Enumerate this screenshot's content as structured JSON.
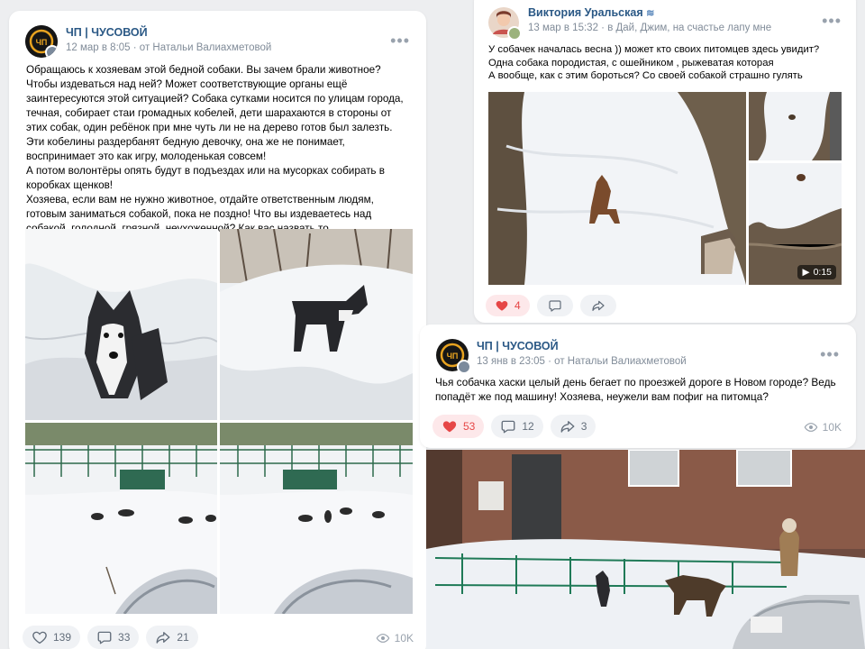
{
  "post1": {
    "author": "ЧП | ЧУСОВОЙ",
    "date": "12 мар в 8:05",
    "from": "· от Натальи Валиахметовой",
    "text": [
      "Обращаюсь к хозяевам этой бедной собаки. Вы зачем брали животное? Чтобы издеваться над ней? Может соответствующие органы ещё заинтересуются этой ситуацией? Собака сутками носится по улицам города, течная, собирает стаи громадных кобелей, дети шарахаются в стороны от этих собак, один ребёнок при мне чуть ли не на дерево готов был залезть. Эти кобелины раздербанят бедную девочку, она же не понимает, воспринимает это как игру, молоденькая совсем!",
      "А потом волонтёры опять будут в подъездах или на мусорках собирать в коробках щенков!",
      "Хозяева, если вам не нужно животное, отдайте ответственным людям, готовым заниматься собакой, пока не поздно! Что вы издеваетесь над собакой, голодной, грязной, неухоженной? Как вас назвать то, бессовестные!!?"
    ],
    "likes": "139",
    "comments": "33",
    "shares": "21",
    "views": "10K"
  },
  "post2": {
    "author": "Виктория Уральская",
    "date": "13 мар в 15:32",
    "location": "· в Дай, Джим, на счастье лапу мне",
    "text": [
      "У собачек началась весна )) может кто своих питомцев здесь увидит? Одна собака породистая, с ошейником , рыжеватая которая",
      "А вообще, как с этим бороться? Со своей собакой страшно гулять"
    ],
    "video_duration": "0:15",
    "likes": "4"
  },
  "post3": {
    "author": "ЧП | ЧУСОВОЙ",
    "date": "13 янв в 23:05",
    "from": "· от Натальи Валиахметовой",
    "text": "Чья собачка хаски целый день бегает по проезжей дороге в Новом городе? Ведь попадёт же под машину! Хозяева, неужели вам пофиг на питомца?",
    "likes": "53",
    "comments": "12",
    "shares": "3",
    "views": "10K"
  },
  "colors": {
    "accent": "#2a5885",
    "like": "#e64646",
    "muted": "#818c99"
  }
}
